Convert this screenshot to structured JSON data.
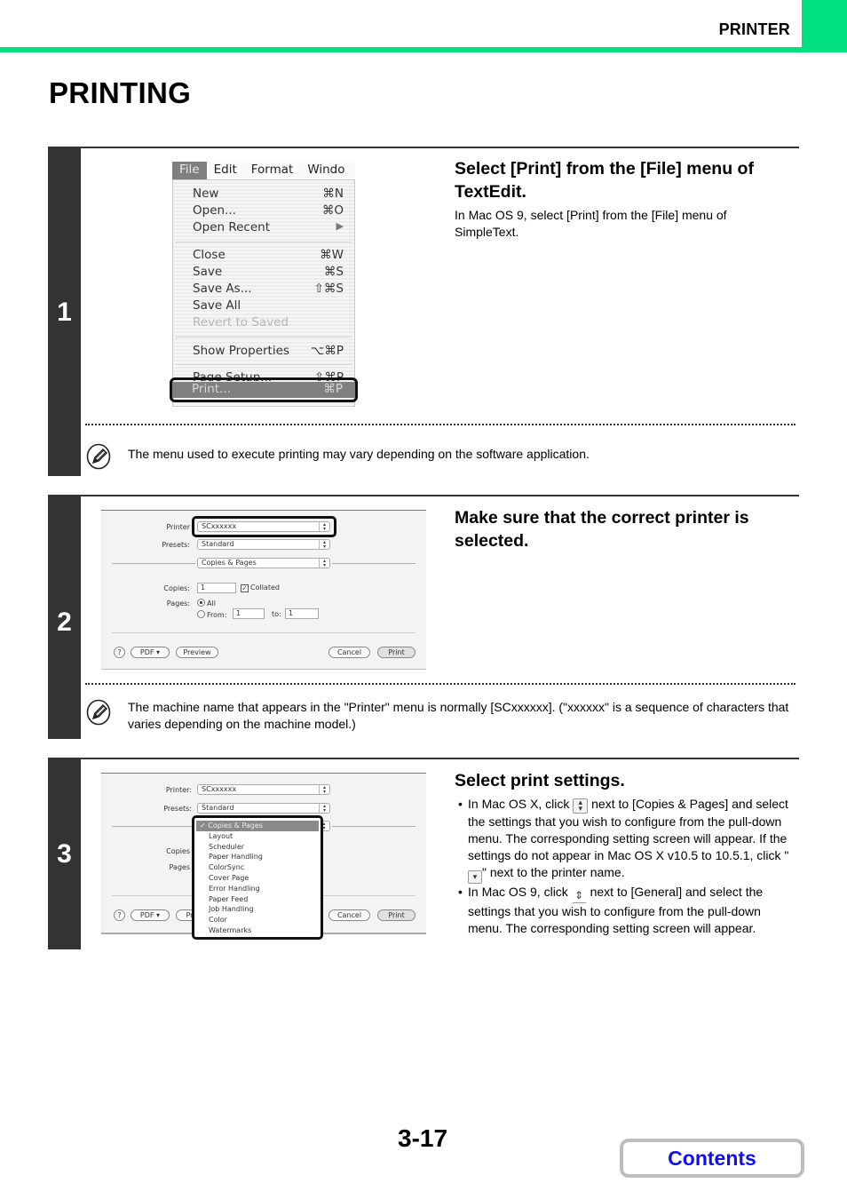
{
  "header": {
    "section_label": "PRINTER",
    "accent_color": "#00e07f"
  },
  "page_title": "PRINTING",
  "steps": [
    {
      "number": "1",
      "title": "Select [Print] from the [File] menu of TextEdit.",
      "description": "In Mac OS 9, select [Print] from the [File] menu of SimpleText.",
      "note": "The menu used to execute printing may vary depending on the software application.",
      "screenshot": {
        "menubar": [
          "File",
          "Edit",
          "Format",
          "Windo"
        ],
        "menu_items": [
          {
            "label": "New",
            "shortcut": "⌘N"
          },
          {
            "label": "Open...",
            "shortcut": "⌘O"
          },
          {
            "label": "Open Recent",
            "shortcut": "▶"
          },
          {
            "label": "Close",
            "shortcut": "⌘W"
          },
          {
            "label": "Save",
            "shortcut": "⌘S"
          },
          {
            "label": "Save As...",
            "shortcut": "⇧⌘S"
          },
          {
            "label": "Save All",
            "shortcut": ""
          },
          {
            "label": "Revert to Saved",
            "shortcut": ""
          },
          {
            "label": "Show Properties",
            "shortcut": "⌥⌘P"
          },
          {
            "label": "Page Setup...",
            "shortcut": "⇧⌘P"
          },
          {
            "label": "Print...",
            "shortcut": "⌘P"
          }
        ]
      }
    },
    {
      "number": "2",
      "title": "Make sure that the correct printer is selected.",
      "note": "The machine name that appears in the \"Printer\" menu is normally [SCxxxxxx]. (\"xxxxxx\" is a sequence of characters that varies depending on the machine model.)",
      "screenshot": {
        "printer_label": "Printer",
        "printer_value": "SCxxxxxx",
        "presets_label": "Presets:",
        "presets_value": "Standard",
        "panel_value": "Copies & Pages",
        "copies_label": "Copies:",
        "copies_value": "1",
        "collated_label": "Collated",
        "pages_label": "Pages:",
        "all_label": "All",
        "from_label": "From:",
        "from_value": "1",
        "to_label": "to:",
        "to_value": "1",
        "help_label": "?",
        "pdf_label": "PDF ▾",
        "preview_label": "Preview",
        "cancel_label": "Cancel",
        "print_label": "Print"
      }
    },
    {
      "number": "3",
      "title": "Select print settings.",
      "bullets": [
        {
          "before": "In Mac OS X, click",
          "after": "next to [Copies & Pages] and select the settings that you wish to configure from the pull-down menu. The corresponding setting screen will appear. If the settings do not appear in Mac OS X v10.5 to 10.5.1, click \"",
          "after2": "\" next to the printer name."
        },
        {
          "before": "In Mac OS 9, click",
          "after": "next to [General] and select the settings that you wish to configure from the pull-down menu. The corresponding setting screen will appear."
        }
      ],
      "screenshot": {
        "printer_label": "Printer:",
        "printer_value": "SCxxxxxx",
        "presets_label": "Presets:",
        "presets_value": "Standard",
        "copies_label": "Copies",
        "pages_label": "Pages",
        "help_label": "?",
        "pdf_label": "PDF ▾",
        "preview_label": "Pr",
        "cancel_label": "Cancel",
        "print_label": "Print",
        "menu_items": [
          "✓ Copies & Pages",
          "Layout",
          "Scheduler",
          "Paper Handling",
          "ColorSync",
          "Cover Page",
          "Error Handling",
          "Paper Feed",
          "Job Handling",
          "Color",
          "Watermarks"
        ]
      }
    }
  ],
  "footer": {
    "page_number": "3-17",
    "contents_label": "Contents",
    "contents_color": "#1010ee"
  }
}
